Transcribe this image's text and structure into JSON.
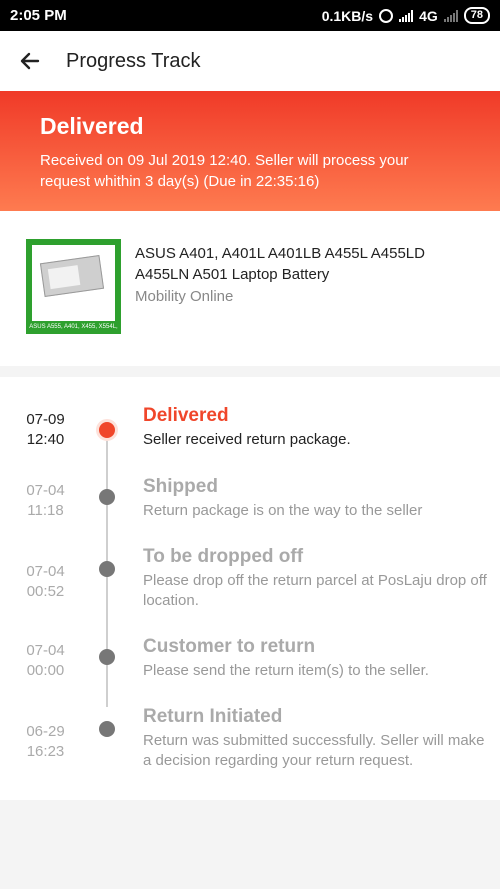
{
  "status_bar": {
    "time": "2:05 PM",
    "net_speed": "0.1KB/s",
    "network": "4G",
    "battery": "78"
  },
  "header": {
    "title": "Progress Track"
  },
  "banner": {
    "title": "Delivered",
    "message": "Received on 09 Jul 2019 12:40. Seller will process your request whithin 3 day(s) (Due in 22:35:16)"
  },
  "product": {
    "name": "ASUS A401, A401L A401LB A455L A455LD A455LN A501  Laptop Battery",
    "shop": "Mobility Online",
    "thumb_caption": "ASUS A555, A401, X455, X554L, F455L"
  },
  "timeline": [
    {
      "date": "07-09",
      "time": "12:40",
      "title": "Delivered",
      "desc": "Seller received return package.",
      "active": true
    },
    {
      "date": "07-04",
      "time": "11:18",
      "title": "Shipped",
      "desc": "Return package is on the way to the seller",
      "active": false
    },
    {
      "date": "07-04",
      "time": "00:52",
      "title": "To be dropped off",
      "desc": "Please drop off the return parcel at PosLaju drop off location.",
      "active": false
    },
    {
      "date": "07-04",
      "time": "00:00",
      "title": "Customer to return",
      "desc": "Please send the return item(s) to the seller.",
      "active": false
    },
    {
      "date": "06-29",
      "time": "16:23",
      "title": "Return Initiated",
      "desc": "Return was submitted successfully. Seller will make a decision regarding your return request.",
      "active": false
    }
  ],
  "colors": {
    "accent": "#f0462a",
    "banner_gradient_start": "#f03a28",
    "banner_gradient_end": "#fe7b50",
    "thumb_green": "#2ea02e"
  },
  "icons": {
    "back": "arrow-left-icon",
    "alarm": "alarm-icon",
    "signal": "signal-icon",
    "battery": "battery-icon"
  }
}
